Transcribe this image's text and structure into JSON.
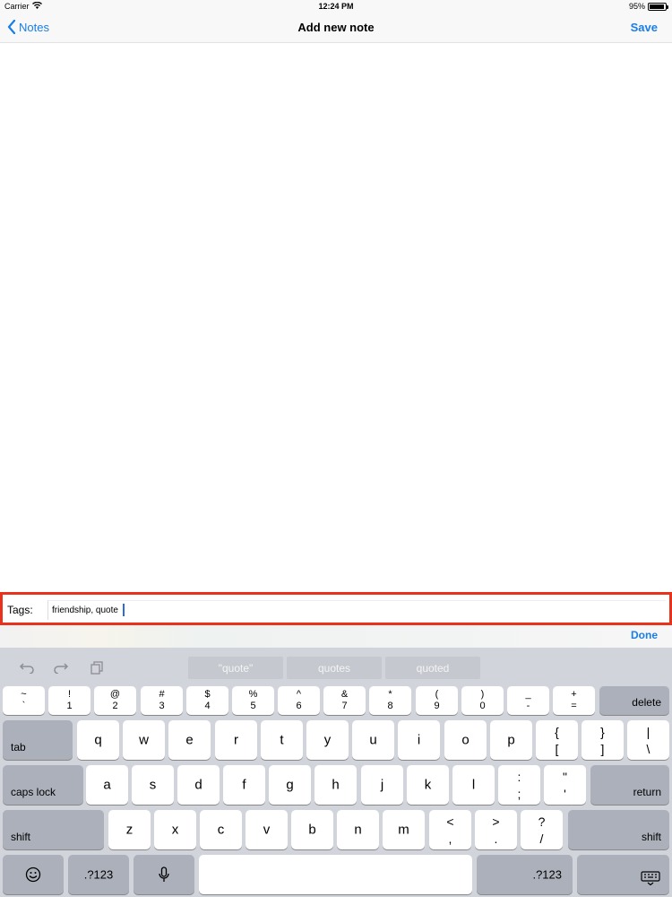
{
  "status": {
    "carrier": "Carrier",
    "time": "12:24 PM",
    "battery": "95%",
    "battery_level": 0.95
  },
  "nav": {
    "back_label": "Notes",
    "title": "Add new note",
    "save_label": "Save"
  },
  "tags": {
    "label": "Tags:",
    "value": "friendship, quote"
  },
  "toolbar": {
    "done_label": "Done"
  },
  "suggestions": [
    "\"quote\"",
    "quotes",
    "quoted"
  ],
  "keys": {
    "num_row": [
      {
        "top": "~",
        "bot": "`"
      },
      {
        "top": "!",
        "bot": "1"
      },
      {
        "top": "@",
        "bot": "2"
      },
      {
        "top": "#",
        "bot": "3"
      },
      {
        "top": "$",
        "bot": "4"
      },
      {
        "top": "%",
        "bot": "5"
      },
      {
        "top": "^",
        "bot": "6"
      },
      {
        "top": "&",
        "bot": "7"
      },
      {
        "top": "*",
        "bot": "8"
      },
      {
        "top": "(",
        "bot": "9"
      },
      {
        "top": ")",
        "bot": "0"
      },
      {
        "top": "_",
        "bot": "-"
      },
      {
        "top": "+",
        "bot": "="
      }
    ],
    "delete": "delete",
    "tab": "tab",
    "row_q": [
      "q",
      "w",
      "e",
      "r",
      "t",
      "y",
      "u",
      "i",
      "o",
      "p"
    ],
    "row_q_extra": [
      {
        "top": "{",
        "bot": "["
      },
      {
        "top": "}",
        "bot": "]"
      },
      {
        "top": "|",
        "bot": "\\"
      }
    ],
    "caps": "caps lock",
    "row_a": [
      "a",
      "s",
      "d",
      "f",
      "g",
      "h",
      "j",
      "k",
      "l"
    ],
    "row_a_extra": [
      {
        "top": ":",
        "bot": ";"
      },
      {
        "top": "\"",
        "bot": "'"
      }
    ],
    "return": "return",
    "shift": "shift",
    "row_z": [
      "z",
      "x",
      "c",
      "v",
      "b",
      "n",
      "m"
    ],
    "row_z_extra": [
      {
        "top": "<",
        "bot": ","
      },
      {
        "top": ">",
        "bot": "."
      },
      {
        "top": "?",
        "bot": "/"
      }
    ],
    "numbers": ".?123"
  }
}
